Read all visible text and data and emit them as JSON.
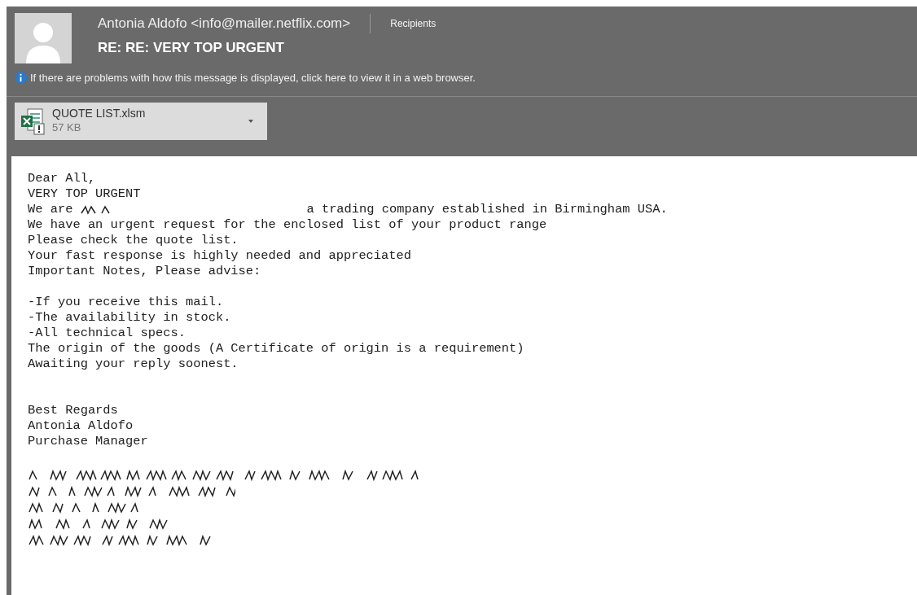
{
  "sender": {
    "name": "Antonia Aldofo <info@mailer.netflix.com>"
  },
  "recipients_label": "Recipients",
  "subject": "RE: RE: VERY TOP URGENT",
  "info_bar": "If there are problems with how this message is displayed, click here to view it in a web browser.",
  "attachment": {
    "name": "QUOTE LIST.xlsm",
    "size": "57 KB"
  },
  "body": {
    "lines": [
      {
        "kind": "text",
        "text": "Dear All,"
      },
      {
        "kind": "text",
        "text": "VERY TOP URGENT"
      },
      {
        "kind": "redacted",
        "before": "We are",
        "after": "a trading company established in Birmingham USA."
      },
      {
        "kind": "text",
        "text": "We have an urgent request for the enclosed list of your product range"
      },
      {
        "kind": "text",
        "text": "Please check the quote list."
      },
      {
        "kind": "text",
        "text": "Your fast response is highly needed and appreciated"
      },
      {
        "kind": "text",
        "text": "Important Notes, Please advise:"
      },
      {
        "kind": "blank"
      },
      {
        "kind": "text",
        "text": "-If you receive this mail."
      },
      {
        "kind": "text",
        "text": "-The availability in stock."
      },
      {
        "kind": "text",
        "text": "-All technical specs."
      },
      {
        "kind": "text",
        "text": "The origin of the goods (A Certificate of origin is a requirement)"
      },
      {
        "kind": "text",
        "text": "Awaiting your reply soonest."
      },
      {
        "kind": "blank"
      },
      {
        "kind": "blank"
      },
      {
        "kind": "text",
        "text": "Best Regards"
      },
      {
        "kind": "text",
        "text": "Antonia Aldofo"
      },
      {
        "kind": "text",
        "text": "Purchase Manager"
      },
      {
        "kind": "blank"
      }
    ]
  }
}
